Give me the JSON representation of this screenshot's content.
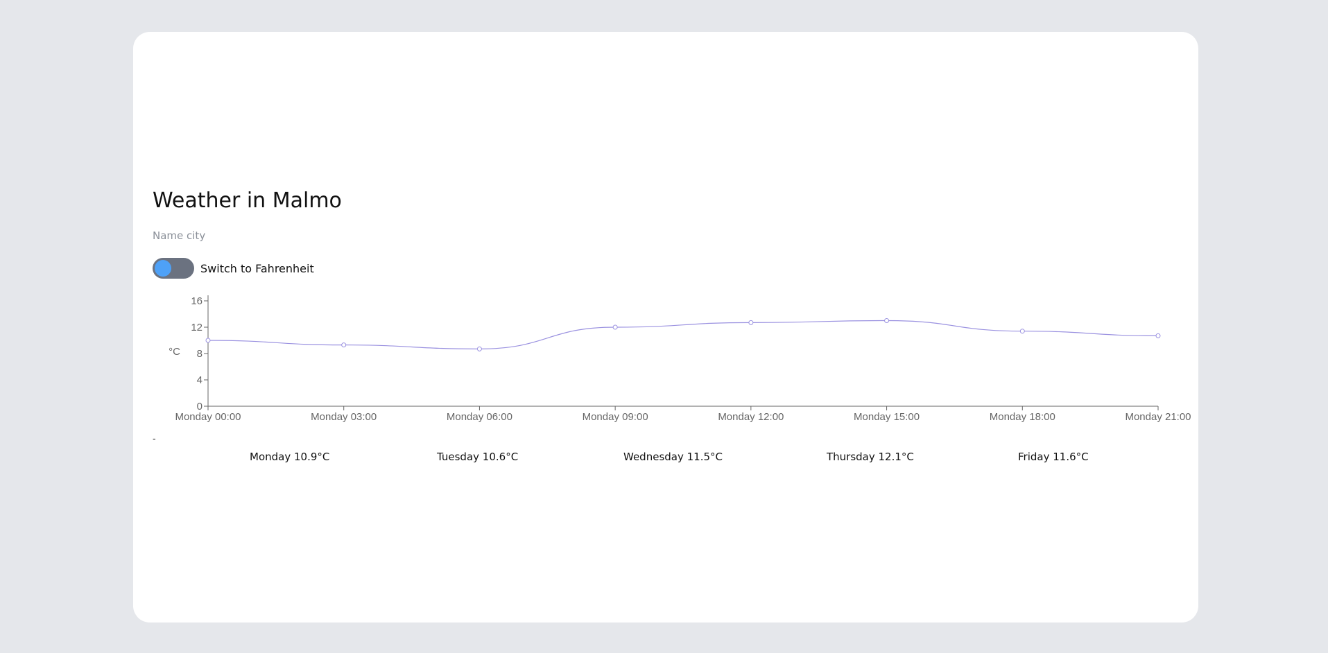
{
  "title": "Weather in Malmo",
  "search": {
    "placeholder": "Name city"
  },
  "toggle": {
    "label": "Switch to Fahrenheit",
    "checked": false
  },
  "colors": {
    "line": "#9a91e0",
    "knob": "#4ea1f7",
    "track": "#6b7280",
    "axis": "#666666"
  },
  "chart_data": {
    "type": "line",
    "xlabel": "",
    "ylabel": "°C",
    "ylim": [
      0,
      16
    ],
    "yticks": [
      "0",
      "4",
      "8",
      "12",
      "16"
    ],
    "grid": false,
    "categories": [
      "Monday 00:00",
      "Monday 03:00",
      "Monday 06:00",
      "Monday 09:00",
      "Monday 12:00",
      "Monday 15:00",
      "Monday 18:00",
      "Monday 21:00"
    ],
    "series": [
      {
        "values": [
          10,
          9.3,
          8.7,
          12,
          12.7,
          13,
          11.4,
          10.7
        ]
      }
    ]
  },
  "separator": "-",
  "forecast": [
    {
      "label": "Monday 10.9°C"
    },
    {
      "label": "Tuesday 10.6°C"
    },
    {
      "label": "Wednesday 11.5°C"
    },
    {
      "label": "Thursday 12.1°C"
    },
    {
      "label": "Friday 11.6°C"
    }
  ]
}
